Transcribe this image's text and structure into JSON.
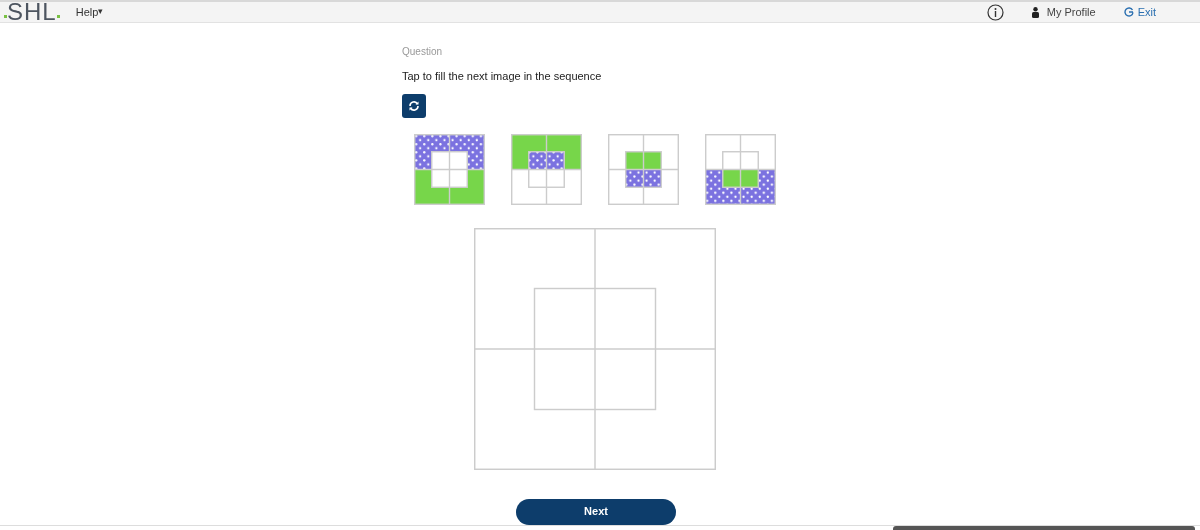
{
  "header": {
    "logo": "SHL",
    "menu": {
      "label": "Help",
      "caret": "▾"
    },
    "profile": "My Profile",
    "exit": "Exit"
  },
  "question": {
    "heading": "Question",
    "prompt": "Tap to fill the next image in the sequence"
  },
  "sequence": [
    {
      "regions": [
        {
          "kind": "dots"
        },
        {
          "kind": "green"
        },
        {
          "kind": "empty"
        },
        {
          "kind": "empty"
        }
      ]
    },
    {
      "regions": [
        {
          "kind": "green"
        },
        {
          "kind": "empty"
        },
        {
          "kind": "dots"
        },
        {
          "kind": "empty"
        }
      ]
    },
    {
      "regions": [
        {
          "kind": "empty"
        },
        {
          "kind": "empty"
        },
        {
          "kind": "green"
        },
        {
          "kind": "dots"
        }
      ]
    },
    {
      "regions": [
        {
          "kind": "empty"
        },
        {
          "kind": "dots"
        },
        {
          "kind": "empty"
        },
        {
          "kind": "green"
        }
      ]
    }
  ],
  "next_button": "Next"
}
